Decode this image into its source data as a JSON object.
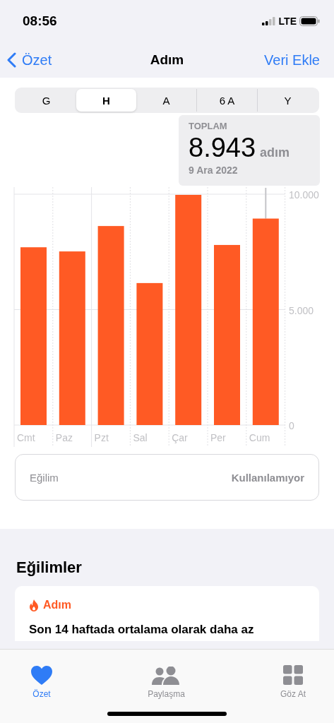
{
  "status_bar": {
    "time": "08:56",
    "network": "LTE"
  },
  "nav": {
    "back": "Özet",
    "title": "Adım",
    "action": "Veri Ekle"
  },
  "segments": [
    {
      "label": "G",
      "selected": false
    },
    {
      "label": "H",
      "selected": true
    },
    {
      "label": "A",
      "selected": false
    },
    {
      "label": "6 A",
      "selected": false
    },
    {
      "label": "Y",
      "selected": false
    }
  ],
  "summary": {
    "label": "TOPLAM",
    "value": "8.943",
    "unit": "adım",
    "date": "9 Ara 2022"
  },
  "chart": {
    "chart_data": {
      "type": "bar",
      "categories": [
        "Cmt",
        "Paz",
        "Pzt",
        "Sal",
        "Çar",
        "Per",
        "Cum"
      ],
      "series": [
        {
          "color": "#ff5a24",
          "values": [
            7700,
            7520,
            8620,
            6150,
            9970,
            7800,
            8943
          ]
        }
      ],
      "ylim": [
        0,
        10000
      ],
      "yticks": [
        {
          "value": 0,
          "label": "0"
        },
        {
          "value": 5000,
          "label": "5.000"
        },
        {
          "value": 10000,
          "label": "10.000"
        }
      ]
    }
  },
  "trend_row": {
    "label": "Eğilim",
    "value": "Kullanılamıyor"
  },
  "trends": {
    "heading": "Eğilimler",
    "card": {
      "category": "Adım",
      "text": "Son 14 haftada ortalama olarak daha az"
    }
  },
  "tab_bar": [
    {
      "label": "Özet",
      "kind": "heart",
      "selected": true
    },
    {
      "label": "Paylaşma",
      "kind": "people",
      "selected": false
    },
    {
      "label": "Göz At",
      "kind": "grid",
      "selected": false
    }
  ]
}
